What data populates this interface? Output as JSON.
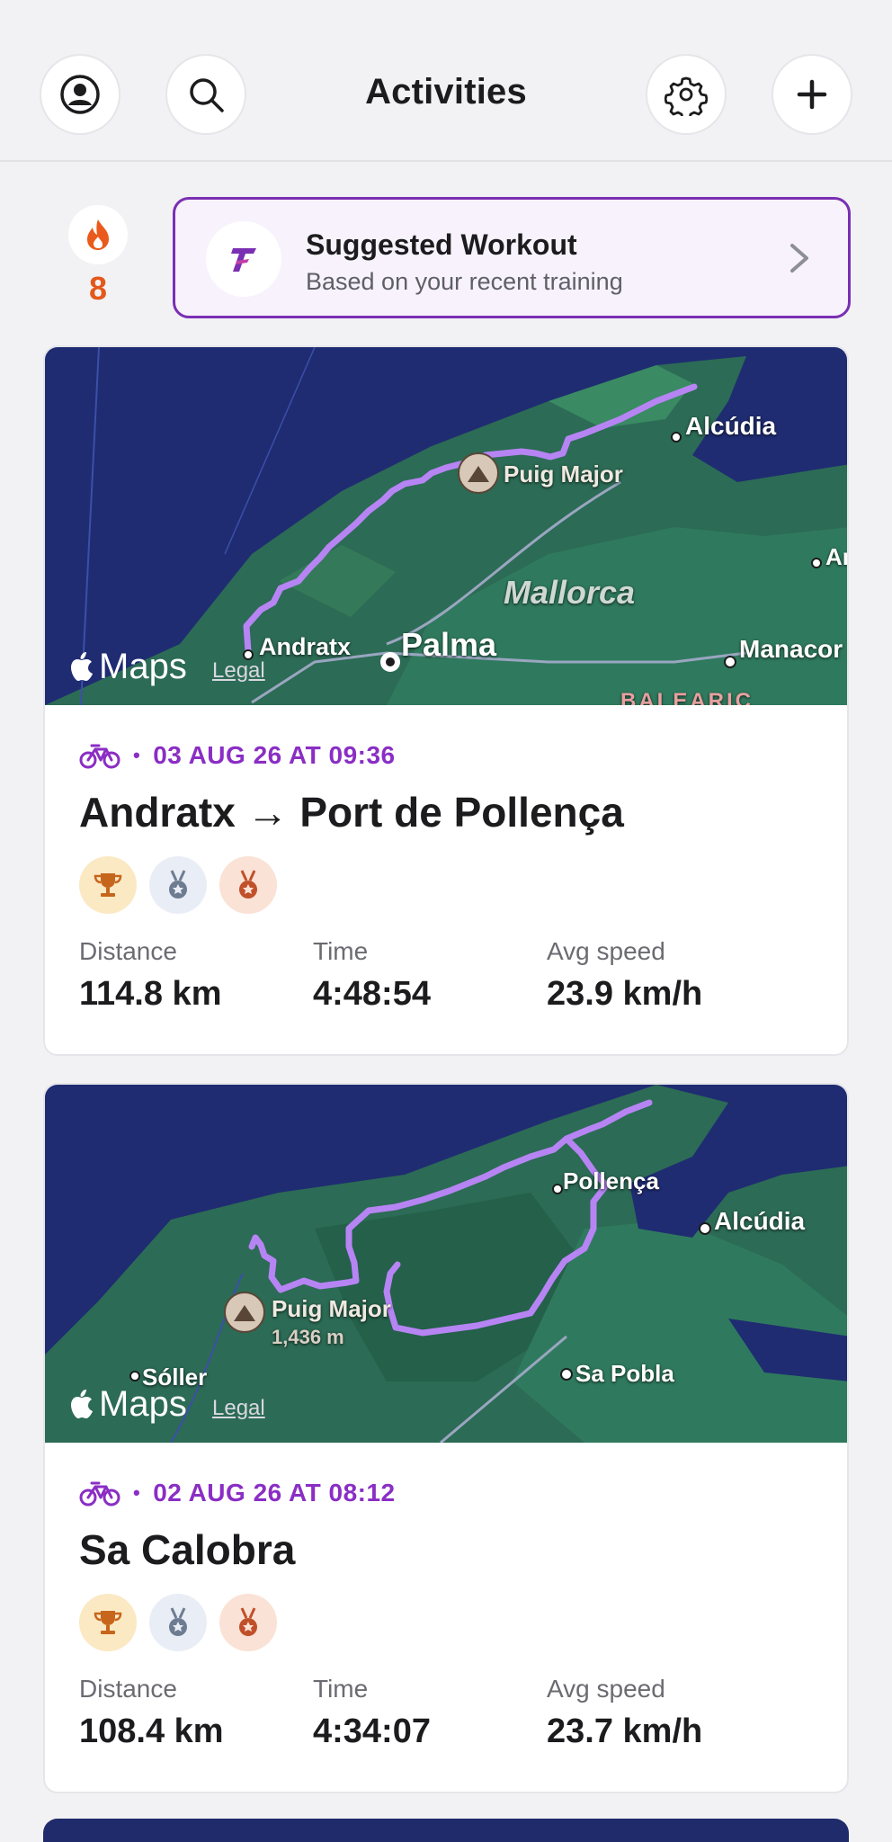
{
  "header": {
    "title": "Activities"
  },
  "streak": {
    "count": "8"
  },
  "suggestion": {
    "title": "Suggested Workout",
    "subtitle": "Based on your recent training"
  },
  "map_brand": "Maps",
  "map_legal": "Legal",
  "activities": [
    {
      "date": "03 AUG 26 AT 09:36",
      "title": "Andratx → Port de Pollença",
      "map_labels": {
        "alcudia": "Alcúdia",
        "puig_major": "Puig Major",
        "ar": "Ar",
        "mallorca": "Mallorca",
        "andratx": "Andratx",
        "palma": "Palma",
        "manacor": "Manacor",
        "baleares": "BALEARIC"
      },
      "stats": [
        {
          "label": "Distance",
          "value": "114.8 km"
        },
        {
          "label": "Time",
          "value": "4:48:54"
        },
        {
          "label": "Avg speed",
          "value": "23.9 km/h"
        }
      ]
    },
    {
      "date": "02 AUG 26 AT 08:12",
      "title": "Sa Calobra",
      "map_labels": {
        "pollenca": "Pollença",
        "alcudia": "Alcúdia",
        "puig_major": "Puig Major",
        "elevation": "1,436 m",
        "soller": "Sóller",
        "sa_pobla": "Sa Pobla"
      },
      "stats": [
        {
          "label": "Distance",
          "value": "108.4 km"
        },
        {
          "label": "Time",
          "value": "4:34:07"
        },
        {
          "label": "Avg speed",
          "value": "23.7 km/h"
        }
      ]
    }
  ]
}
